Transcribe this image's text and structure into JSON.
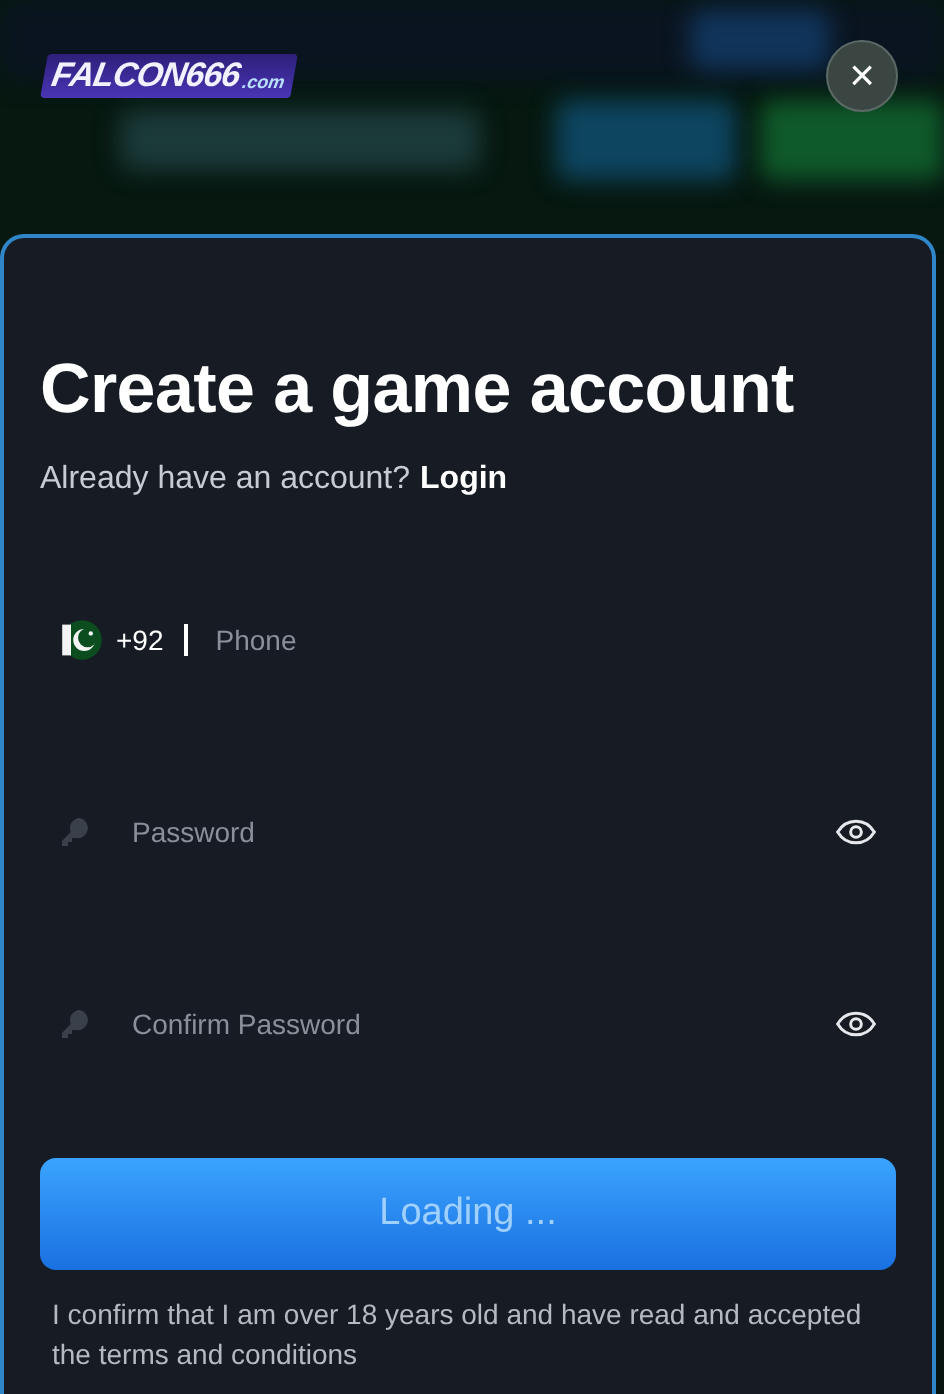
{
  "header": {
    "logo": {
      "name": "FALCON666",
      "suffix": ".com"
    },
    "close": "×"
  },
  "form": {
    "title": "Create a game account",
    "login_prompt": "Already have an account?",
    "login_link": "Login",
    "fields": [
      {
        "kind": "phone",
        "country_code": "+92",
        "placeholder": "Phone"
      },
      {
        "kind": "password",
        "placeholder": "Password"
      },
      {
        "kind": "password",
        "placeholder": "Confirm Password"
      }
    ],
    "submit": {
      "label": "Loading ...",
      "disabled": true
    },
    "terms": "I confirm that I am over 18 years old and have read and accepted the terms and conditions"
  }
}
